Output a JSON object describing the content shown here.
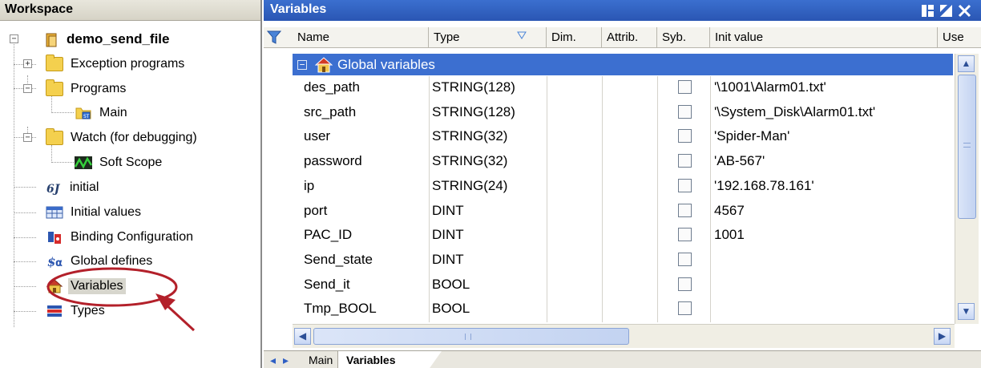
{
  "workspace": {
    "title": "Workspace",
    "tree": {
      "root": "demo_send_file",
      "exception_programs": "Exception programs",
      "programs": "Programs",
      "main": "Main",
      "watch": "Watch (for debugging)",
      "soft_scope": "Soft Scope",
      "initial": "initial",
      "initial_values": "Initial values",
      "binding_configuration": "Binding Configuration",
      "global_defines": "Global defines",
      "variables": "Variables",
      "types": "Types"
    }
  },
  "variables_panel": {
    "title": "Variables",
    "columns": {
      "name": "Name",
      "type": "Type",
      "dim": "Dim.",
      "attrib": "Attrib.",
      "syb": "Syb.",
      "init_value": "Init value",
      "user": "Use"
    },
    "group_label": "Global variables",
    "rows": [
      {
        "name": "des_path",
        "type": "STRING(128)",
        "init": "'\\1001\\Alarm01.txt'"
      },
      {
        "name": "src_path",
        "type": "STRING(128)",
        "init": "'\\System_Disk\\Alarm01.txt'"
      },
      {
        "name": "user",
        "type": "STRING(32)",
        "init": "'Spider-Man'"
      },
      {
        "name": "password",
        "type": "STRING(32)",
        "init": "'AB-567'"
      },
      {
        "name": "ip",
        "type": "STRING(24)",
        "init": "'192.168.78.161'"
      },
      {
        "name": "port",
        "type": "DINT",
        "init": "4567"
      },
      {
        "name": "PAC_ID",
        "type": "DINT",
        "init": "1001"
      },
      {
        "name": "Send_state",
        "type": "DINT",
        "init": ""
      },
      {
        "name": "Send_it",
        "type": "BOOL",
        "init": ""
      },
      {
        "name": "Tmp_BOOL",
        "type": "BOOL",
        "init": ""
      }
    ],
    "tabs": [
      "Main",
      "Variables"
    ]
  },
  "colors": {
    "title_blue": "#2f5fc4",
    "selection_blue": "#3c6fd0",
    "annotation_red": "#b3202a"
  },
  "icons": [
    "filter-icon",
    "home-icon",
    "folder-icon",
    "program-icon",
    "scope-icon",
    "initial-icon",
    "table-icon",
    "binding-icon",
    "defines-icon",
    "variables-icon",
    "types-icon"
  ]
}
